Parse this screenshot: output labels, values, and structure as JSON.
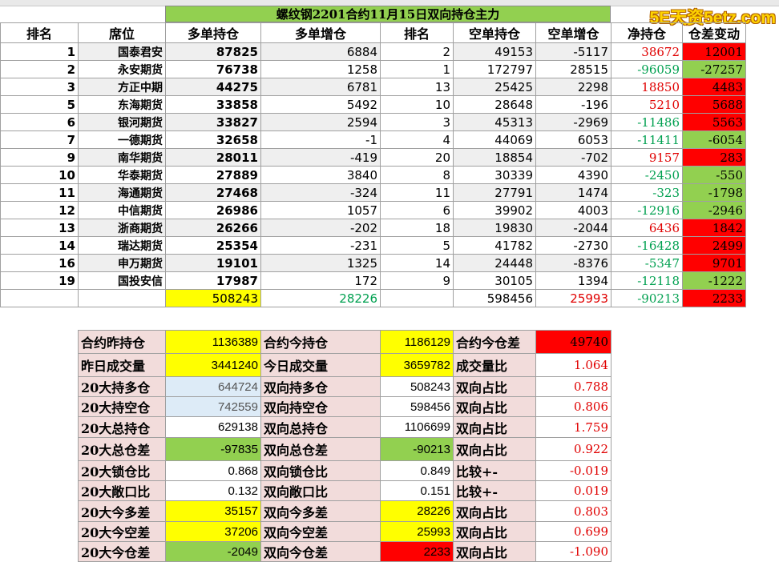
{
  "watermark": "5E天资5etz.com",
  "title": "螺纹钢2201合约11月15日双向持仓主力",
  "headers": [
    "排名",
    "席位",
    "多单持仓",
    "多单增仓",
    "排名",
    "空单持仓",
    "空单增仓",
    "净持仓",
    "仓差变动"
  ],
  "rows": [
    {
      "rank": "1",
      "seat": "国泰君安",
      "long": "87825",
      "long_chg": "6884",
      "srank": "2",
      "short": "49153",
      "short_chg": "-5117",
      "net": "38672",
      "diff": "12001"
    },
    {
      "rank": "2",
      "seat": "永安期货",
      "long": "76738",
      "long_chg": "1258",
      "srank": "1",
      "short": "172797",
      "short_chg": "28515",
      "net": "-96059",
      "diff": "-27257"
    },
    {
      "rank": "3",
      "seat": "方正中期",
      "long": "44275",
      "long_chg": "6781",
      "srank": "13",
      "short": "25425",
      "short_chg": "2298",
      "net": "18850",
      "diff": "4483"
    },
    {
      "rank": "5",
      "seat": "东海期货",
      "long": "33858",
      "long_chg": "5492",
      "srank": "10",
      "short": "28648",
      "short_chg": "-196",
      "net": "5210",
      "diff": "5688"
    },
    {
      "rank": "6",
      "seat": "银河期货",
      "long": "33827",
      "long_chg": "2594",
      "srank": "3",
      "short": "45313",
      "short_chg": "-2969",
      "net": "-11486",
      "diff": "5563"
    },
    {
      "rank": "7",
      "seat": "一德期货",
      "long": "32658",
      "long_chg": "-1",
      "srank": "4",
      "short": "44069",
      "short_chg": "6053",
      "net": "-11411",
      "diff": "-6054"
    },
    {
      "rank": "9",
      "seat": "南华期货",
      "long": "28011",
      "long_chg": "-419",
      "srank": "20",
      "short": "18854",
      "short_chg": "-702",
      "net": "9157",
      "diff": "283"
    },
    {
      "rank": "10",
      "seat": "华泰期货",
      "long": "27889",
      "long_chg": "3840",
      "srank": "8",
      "short": "30339",
      "short_chg": "4390",
      "net": "-2450",
      "diff": "-550"
    },
    {
      "rank": "11",
      "seat": "海通期货",
      "long": "27468",
      "long_chg": "-324",
      "srank": "11",
      "short": "27791",
      "short_chg": "1474",
      "net": "-323",
      "diff": "-1798"
    },
    {
      "rank": "12",
      "seat": "中信期货",
      "long": "26986",
      "long_chg": "1057",
      "srank": "6",
      "short": "39902",
      "short_chg": "4003",
      "net": "-12916",
      "diff": "-2946"
    },
    {
      "rank": "13",
      "seat": "浙商期货",
      "long": "26266",
      "long_chg": "-202",
      "srank": "18",
      "short": "19830",
      "short_chg": "-2044",
      "net": "6436",
      "diff": "1842"
    },
    {
      "rank": "14",
      "seat": "瑞达期货",
      "long": "25354",
      "long_chg": "-231",
      "srank": "5",
      "short": "41782",
      "short_chg": "-2730",
      "net": "-16428",
      "diff": "2499"
    },
    {
      "rank": "16",
      "seat": "申万期货",
      "long": "19101",
      "long_chg": "1325",
      "srank": "14",
      "short": "24448",
      "short_chg": "-8376",
      "net": "-5347",
      "diff": "9701"
    },
    {
      "rank": "19",
      "seat": "国投安信",
      "long": "17987",
      "long_chg": "172",
      "srank": "9",
      "short": "30105",
      "short_chg": "1394",
      "net": "-12118",
      "diff": "-1222"
    }
  ],
  "totals": {
    "long": "508243",
    "long_chg": "28226",
    "short": "598456",
    "short_chg": "25993",
    "net": "-90213",
    "diff": "2233"
  },
  "summary": [
    {
      "l1": "合约昨持仓",
      "v1": "1136389",
      "l2": "合约今持仓",
      "v2": "1186129",
      "l3": "合约今仓差",
      "v3": "49740"
    },
    {
      "l1": "昨日成交量",
      "v1": "3441240",
      "l2": "今日成交量",
      "v2": "3659782",
      "l3": "成交量比",
      "v3": "1.064"
    },
    {
      "l1": "20大持多仓",
      "v1": "644724",
      "l2": "双向持多仓",
      "v2": "508243",
      "l3": "双向占比",
      "v3": "0.788"
    },
    {
      "l1": "20大持空仓",
      "v1": "742559",
      "l2": "双向持空仓",
      "v2": "598456",
      "l3": "双向占比",
      "v3": "0.806"
    },
    {
      "l1": "20大总持仓",
      "v1": "629138",
      "l2": "双向总持仓",
      "v2": "1106699",
      "l3": "双向占比",
      "v3": "1.759"
    },
    {
      "l1": "20大总仓差",
      "v1": "-97835",
      "l2": "双向总仓差",
      "v2": "-90213",
      "l3": "双向占比",
      "v3": "0.922"
    },
    {
      "l1": "20大锁仓比",
      "v1": "0.868",
      "l2": "双向锁仓比",
      "v2": "0.849",
      "l3": "比较+-",
      "v3": "-0.019"
    },
    {
      "l1": "20大敞口比",
      "v1": "0.132",
      "l2": "双向敞口比",
      "v2": "0.151",
      "l3": "比较+-",
      "v3": "0.019"
    },
    {
      "l1": "20大今多差",
      "v1": "35157",
      "l2": "双向今多差",
      "v2": "28226",
      "l3": "双向占比",
      "v3": "0.803"
    },
    {
      "l1": "20大今空差",
      "v1": "37206",
      "l2": "双向今空差",
      "v2": "25993",
      "l3": "双向占比",
      "v3": "0.699"
    },
    {
      "l1": "20大今仓差",
      "v1": "-2049",
      "l2": "双向今仓差",
      "v2": "2233",
      "l3": "双向占比",
      "v3": "-1.090"
    }
  ],
  "colors": {
    "title_bg": "#92d050",
    "positive_bg": "#ff0000",
    "negative_bg": "#92d050",
    "highlight": "#ffff00",
    "label_bg": "#f2dcdb",
    "net_positive": "#e00000",
    "net_negative": "#00a050"
  }
}
